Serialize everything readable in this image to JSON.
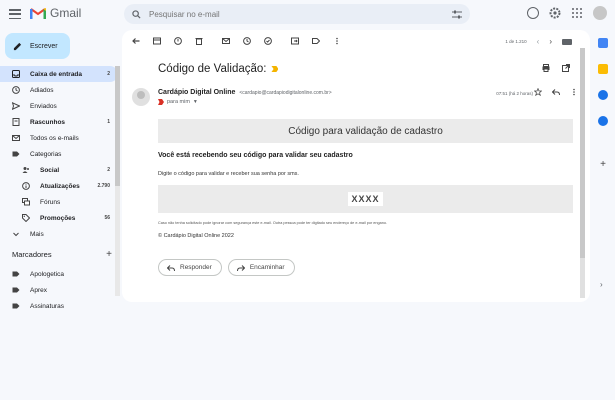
{
  "app": {
    "name": "Gmail"
  },
  "search": {
    "placeholder": "Pesquisar no e-mail"
  },
  "compose": {
    "label": "Escrever"
  },
  "nav": {
    "inbox": {
      "label": "Caixa de entrada",
      "count": "2"
    },
    "snoozed": {
      "label": "Adiados"
    },
    "sent": {
      "label": "Enviados"
    },
    "drafts": {
      "label": "Rascunhos",
      "count": "1"
    },
    "all": {
      "label": "Todos os e-mails"
    },
    "categories": {
      "label": "Categorias"
    },
    "social": {
      "label": "Social",
      "count": "2"
    },
    "updates": {
      "label": "Atualizações",
      "count": "2.790"
    },
    "forums": {
      "label": "Fóruns"
    },
    "promotions": {
      "label": "Promoções",
      "count": "56"
    },
    "more": {
      "label": "Mais"
    }
  },
  "labels": {
    "title": "Marcadores",
    "items": [
      "Apologetica",
      "Aprex",
      "Assinaturas"
    ]
  },
  "toolbar": {
    "pagination": "1 de 1.210"
  },
  "email": {
    "subject": "Código de Validação:",
    "sender_name": "Cardápio Digital Online",
    "sender_email": "<cardapio@cardapiodigitalonline.com.br>",
    "to": "para mim",
    "date": "07:51 (há 2 horas)",
    "banner": "Código para validação de cadastro",
    "heading": "Você está recebendo seu código para validar seu cadastro",
    "instruction": "Digite o código para validar e receber sua senha por sms.",
    "code": "XXXX",
    "fine_print": "Caso não tenha solicitado pode ignorar com segurança este e-mail. Outra pessoa pode ter digitado seu endereço de e-mail por engano.",
    "copyright": "© Cardápio Digital Online 2022"
  },
  "actions": {
    "reply": "Responder",
    "forward": "Encaminhar"
  },
  "colors": {
    "accent": "#c2e7ff",
    "active_nav": "#d3e3fd",
    "background": "#f6f8fc"
  }
}
